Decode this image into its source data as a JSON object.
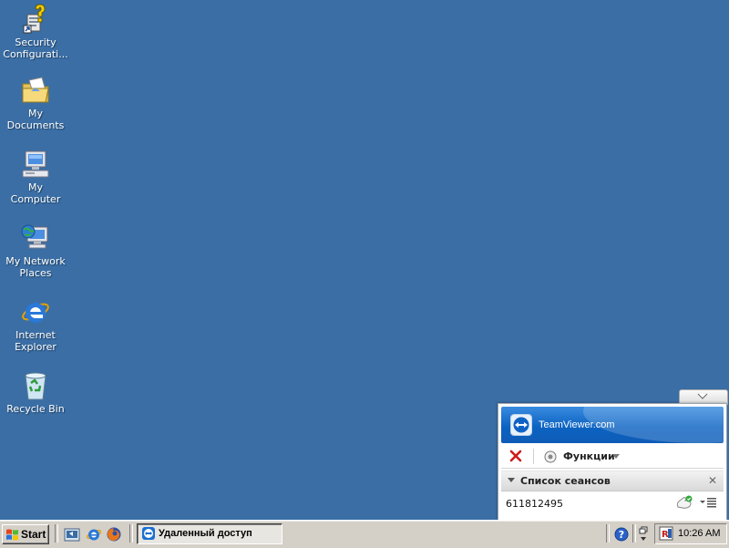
{
  "desktop": {
    "icons": [
      {
        "label": "Security Configurati...",
        "icon": "security-config-icon"
      },
      {
        "label": "My Documents",
        "icon": "folder-documents-icon"
      },
      {
        "label": "My Computer",
        "icon": "computer-icon"
      },
      {
        "label": "My Network Places",
        "icon": "network-places-icon"
      },
      {
        "label": "Internet Explorer",
        "icon": "internet-explorer-icon"
      },
      {
        "label": "Recycle Bin",
        "icon": "recycle-bin-icon"
      }
    ],
    "background_color": "#3a6ea5"
  },
  "teamviewer": {
    "brand": "TeamViewer.com",
    "toolbar": {
      "functions_label": "Функции"
    },
    "sessions": {
      "header": "Список сеансов",
      "close_glyph": "✕",
      "items": [
        {
          "id": "611812495"
        }
      ]
    },
    "header_color": "#0e63c4"
  },
  "taskbar": {
    "start_label": "Start",
    "task_label": "Удаленный доступ",
    "clock": "10:26 AM"
  }
}
